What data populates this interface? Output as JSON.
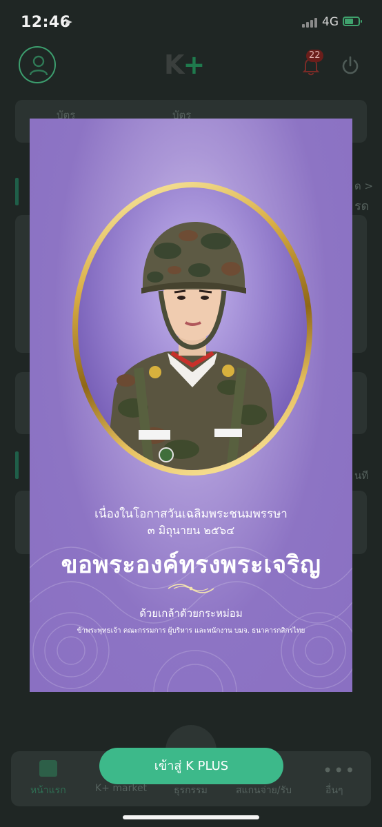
{
  "status_bar": {
    "time": "12:46",
    "network": "4G"
  },
  "header": {
    "logo_text": "K",
    "logo_plus": "+",
    "notification_count": "22"
  },
  "background": {
    "quick_items": [
      "บัตร",
      "บัตร"
    ],
    "partial_texts": [
      "ด >",
      "รด",
      "นที"
    ]
  },
  "popup": {
    "line1": "เนื่องในโอกาสวันเฉลิมพระชนมพรรษา",
    "line2": "๓ มิถุนายน ๒๕๖๔",
    "headline": "ขอพระองค์ทรงพระเจริญ",
    "line3": "ด้วยเกล้าด้วยกระหม่อม",
    "line4": "ข้าพระพุทธเจ้า คณะกรรมการ ผู้บริหาร และพนักงาน บมจ. ธนาคารกสิกรไทย"
  },
  "cta": {
    "label": "เข้าสู่ K PLUS"
  },
  "bottom_nav": {
    "items": [
      {
        "label": "หน้าแรก",
        "icon": "home-icon"
      },
      {
        "label": "K+ market",
        "icon": "market-icon"
      },
      {
        "label": "ธุรกรรม",
        "icon": "transaction-icon"
      },
      {
        "label": "สแกนจ่าย/รับ",
        "icon": "scan-icon"
      },
      {
        "label": "อื่นๆ",
        "icon": "more-icon"
      }
    ]
  },
  "colors": {
    "accent": "#3db98a",
    "brand_green": "#1f7a4d",
    "popup_purple": "#8d74c4",
    "gold": "#d9ae45"
  }
}
